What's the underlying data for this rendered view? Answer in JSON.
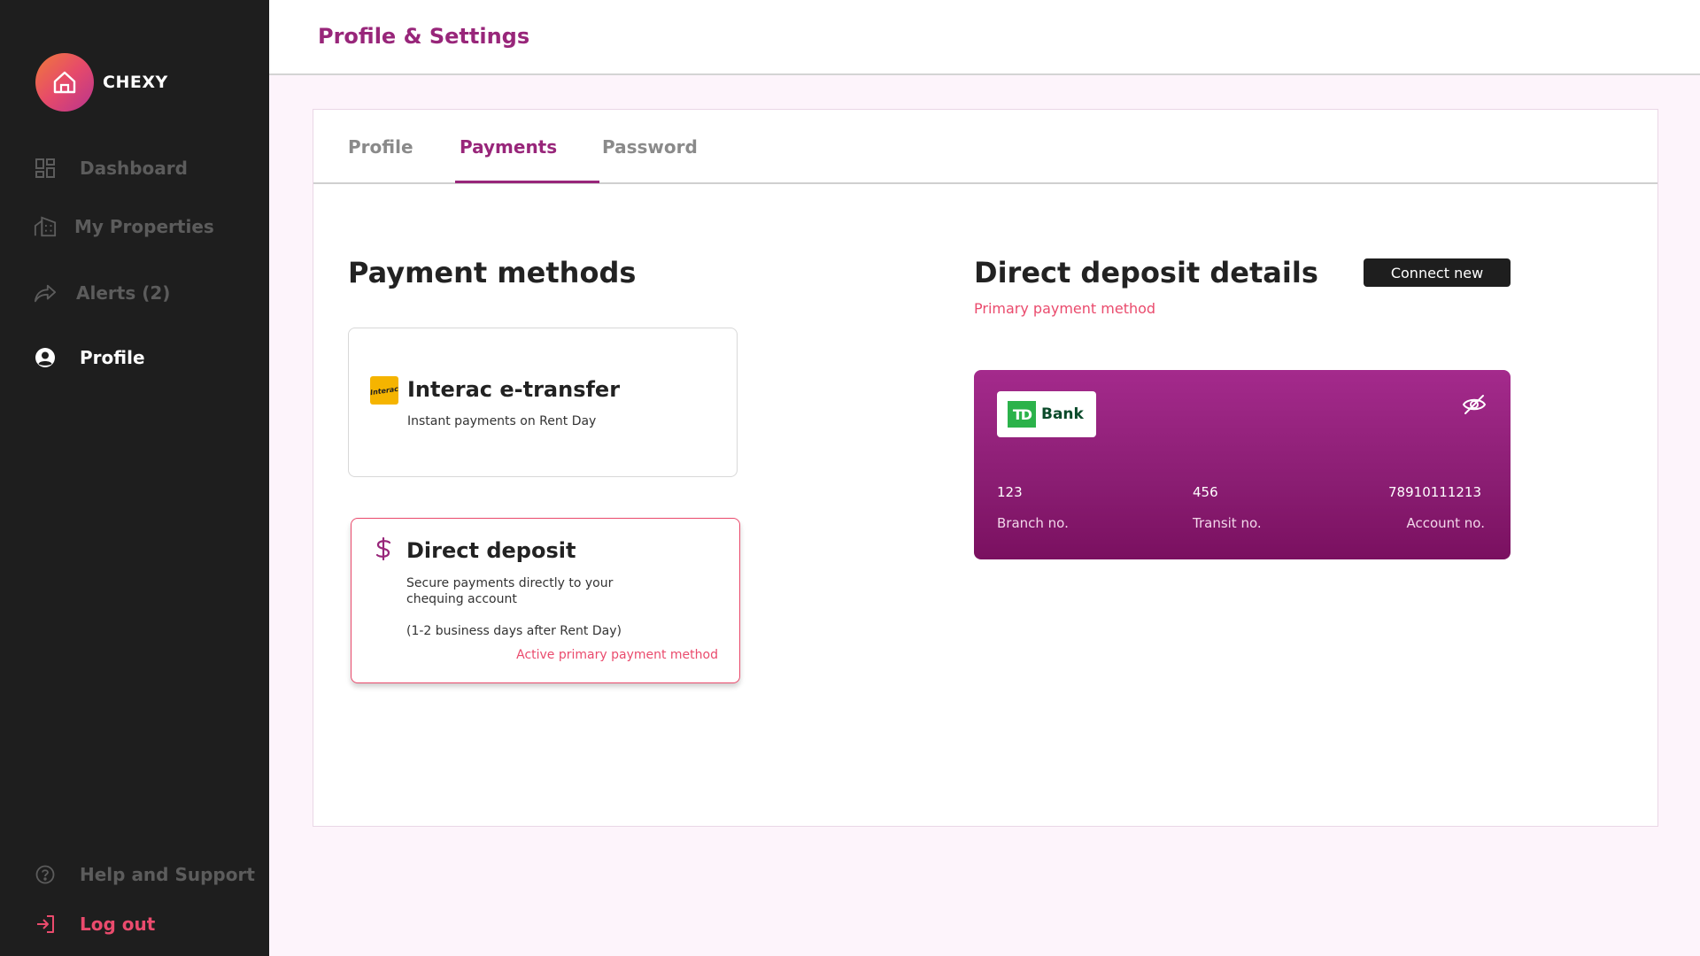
{
  "brand": {
    "name": "CHEXY"
  },
  "sidebar": {
    "items": [
      {
        "label": "Dashboard",
        "icon": "dashboard-icon"
      },
      {
        "label": "My Properties",
        "icon": "building-icon"
      },
      {
        "label": "Alerts (2)",
        "icon": "share-arrow-icon"
      },
      {
        "label": "Profile",
        "icon": "user-circle-icon",
        "active": true
      }
    ],
    "help_label": "Help and Support",
    "logout_label": "Log out"
  },
  "header": {
    "title": "Profile & Settings"
  },
  "tabs": [
    {
      "label": "Profile"
    },
    {
      "label": "Payments",
      "active": true
    },
    {
      "label": "Password"
    }
  ],
  "payment_methods": {
    "title": "Payment methods",
    "interac": {
      "logo_text": "Interac",
      "title": "Interac e-transfer",
      "description": "Instant payments on Rent Day"
    },
    "direct_deposit": {
      "title": "Direct deposit",
      "description": "Secure payments directly to your chequing account",
      "timing": "(1-2 business days after Rent Day)",
      "status": "Active primary payment method"
    }
  },
  "direct_deposit_details": {
    "title": "Direct deposit details",
    "subtitle": "Primary payment method",
    "connect_label": "Connect new",
    "bank": {
      "logo_mark": "TD",
      "logo_word": "Bank",
      "branch_no": "123",
      "branch_label": "Branch no.",
      "transit_no": "456",
      "transit_label": "Transit no.",
      "account_no": "78910111213",
      "account_label": "Account no."
    }
  },
  "colors": {
    "accent": "#98267a",
    "pink": "#ea4b6d",
    "sidebar_bg": "#1e1e1e",
    "page_bg": "#fdf4fb"
  }
}
